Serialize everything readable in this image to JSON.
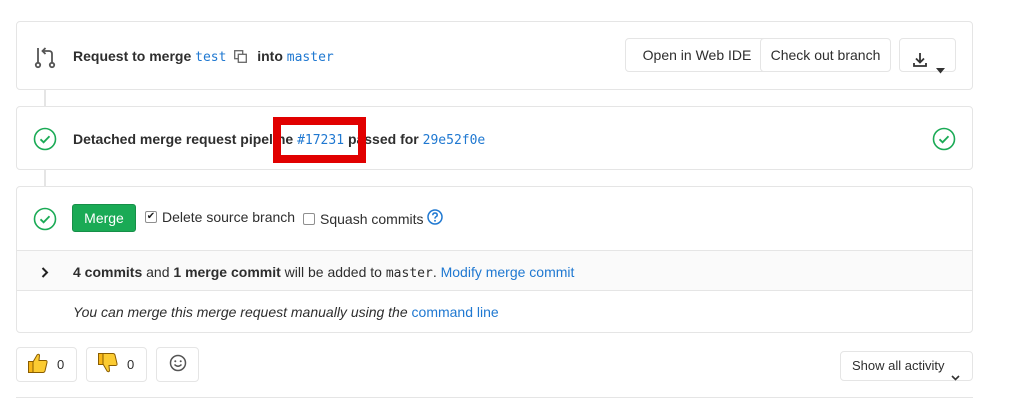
{
  "header": {
    "prefix": "Request to merge",
    "source_branch": "test",
    "into": "into",
    "target_branch": "master",
    "buttons": {
      "web_ide": "Open in Web IDE",
      "checkout": "Check out branch"
    },
    "icons": {
      "merge_request": "merge-request-icon",
      "copy": "copy-icon",
      "download": "download-icon"
    }
  },
  "pipeline": {
    "text_before": "Detached merge request pipeline",
    "pipeline_id": "#17231",
    "text_after": "passed for",
    "commit_sha": "29e52f0e",
    "status": "passed",
    "status_color": "#1aaa55"
  },
  "merge": {
    "button": "Merge",
    "delete_source_label": "Delete source branch",
    "delete_source_checked": true,
    "squash_label": "Squash commits",
    "squash_checked": false,
    "commits_count": "4 commits",
    "and": "and",
    "merge_commit_count": "1 merge commit",
    "added_to": "will be added to",
    "target": "master",
    "modify_link": "Modify merge commit",
    "manual_text": "You can merge this merge request manually using the",
    "command_line_link": "command line",
    "accent_color": "#1aaa55"
  },
  "reactions": {
    "thumbs_up_count": "0",
    "thumbs_down_count": "0"
  },
  "activity": {
    "filter_label": "Show all activity"
  },
  "colors": {
    "link": "#1f78d1",
    "success": "#1aaa55",
    "highlight": "#e10000"
  }
}
